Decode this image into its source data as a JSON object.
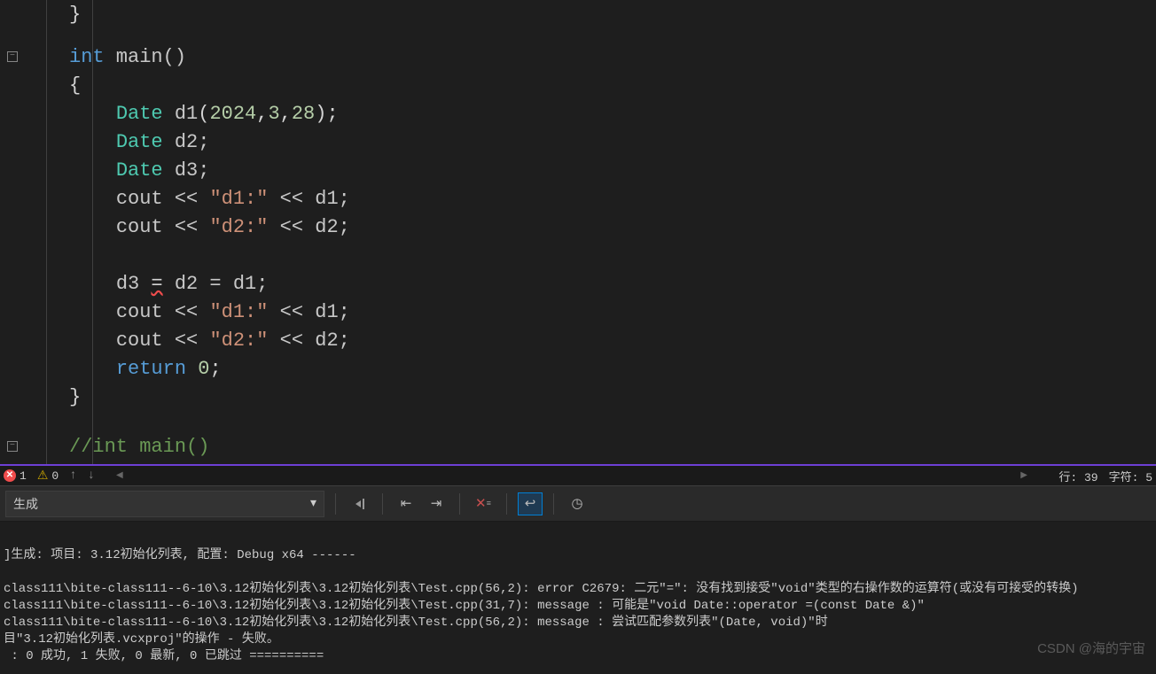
{
  "code": {
    "l0": "}",
    "l1_p1": "int",
    "l1_p2": " main()",
    "l2": "{",
    "l3_p1": "Date",
    "l3_p2": " d1",
    "l3_p3": "(",
    "l3_y": "2024",
    "l3_c1": ",",
    "l3_m": "3",
    "l3_c2": ",",
    "l3_d": "28",
    "l3_p4": ");",
    "l4_p1": "Date",
    "l4_p2": " d2;",
    "l5_p1": "Date",
    "l5_p2": " d3;",
    "l6_p1": "cout << ",
    "l6_s": "\"d1:\"",
    "l6_p2": " << d1;",
    "l7_p1": "cout << ",
    "l7_s": "\"d2:\"",
    "l7_p2": " << d2;",
    "l8": "",
    "l9_p1": "d3 ",
    "l9_eq1": "=",
    "l9_p2": " d2 = d1;",
    "l10_p1": "cout << ",
    "l10_s": "\"d1:\"",
    "l10_p2": " << d1;",
    "l11_p1": "cout << ",
    "l11_s": "\"d2:\"",
    "l11_p2": " << d2;",
    "l12_p1": "return",
    "l12_p2": " ",
    "l12_n": "0",
    "l12_p3": ";",
    "l13": "}",
    "l14": "",
    "l15": "//int main()"
  },
  "status": {
    "errors": "1",
    "warnings": "0",
    "line_label": "行:",
    "line_val": "39",
    "char_label": "字符:",
    "char_val": "5"
  },
  "output": {
    "dropdown_label": "生成",
    "line1": "]生成: 项目: 3.12初始化列表, 配置: Debug x64 ------",
    "line2": "class111\\bite-class111--6-10\\3.12初始化列表\\3.12初始化列表\\Test.cpp(56,2): error C2679: 二元\"=\": 没有找到接受\"void\"类型的右操作数的运算符(或没有可接受的转换)",
    "line3": "class111\\bite-class111--6-10\\3.12初始化列表\\3.12初始化列表\\Test.cpp(31,7): message : 可能是\"void Date::operator =(const Date &)\"",
    "line4": "class111\\bite-class111--6-10\\3.12初始化列表\\3.12初始化列表\\Test.cpp(56,2): message : 尝试匹配参数列表\"(Date, void)\"时",
    "line5": "目\"3.12初始化列表.vcxproj\"的操作 - 失败。",
    "line6": " : 0 成功, 1 失败, 0 最新, 0 已跳过 =========="
  },
  "watermark": "CSDN @海的宇宙"
}
